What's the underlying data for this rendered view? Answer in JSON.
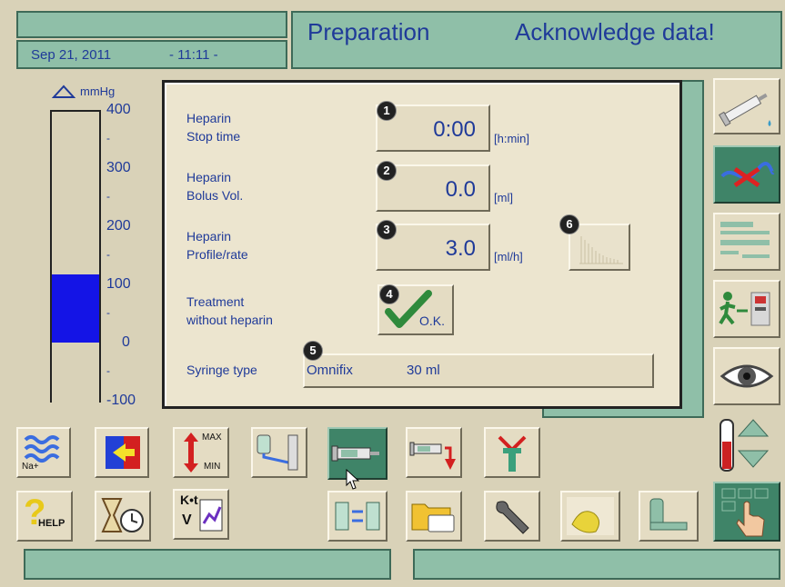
{
  "header": {
    "date": "Sep 21, 2011",
    "time": "- 11:11 -",
    "title": "Preparation",
    "message": "Acknowledge data!"
  },
  "pressure_scale": {
    "unit": "mmHg",
    "ticks": [
      "400",
      "300",
      "200",
      "100",
      "0",
      "-100"
    ],
    "minor_marks": [
      "-",
      "-",
      "-",
      "-",
      "-"
    ],
    "bar_value_upper": 120,
    "bar_value_lower": 0,
    "range": [
      -100,
      400
    ],
    "bar_color": "#1414e6"
  },
  "dialog": {
    "fields": [
      {
        "badge": "1",
        "label_line1": "Heparin",
        "label_line2": "Stop time",
        "value": "0:00",
        "unit": "[h:min]"
      },
      {
        "badge": "2",
        "label_line1": "Heparin",
        "label_line2": "Bolus Vol.",
        "value": "0.0",
        "unit": "[ml]"
      },
      {
        "badge": "3",
        "label_line1": "Heparin",
        "label_line2": "Profile/rate",
        "value": "3.0",
        "unit": "[ml/h]"
      }
    ],
    "profile_badge": "6",
    "treatment": {
      "badge": "4",
      "label_line1": "Treatment",
      "label_line2": "without heparin",
      "ok_label": "O.K."
    },
    "syringe": {
      "badge": "5",
      "label": "Syringe type",
      "name": "Omnifix",
      "size": "30 ml"
    }
  },
  "toolbar_row1": {
    "na_label": "Na+",
    "max_label": "MAX",
    "min_label": "MIN"
  },
  "toolbar_row2": {
    "help_label": "HELP",
    "kt_label": "K•t",
    "v_label": "V"
  },
  "colors": {
    "accent_teal": "#8fbfa8",
    "selected_teal": "#3f8468",
    "background": "#d9d2b8",
    "text_blue": "#1f3a99"
  }
}
